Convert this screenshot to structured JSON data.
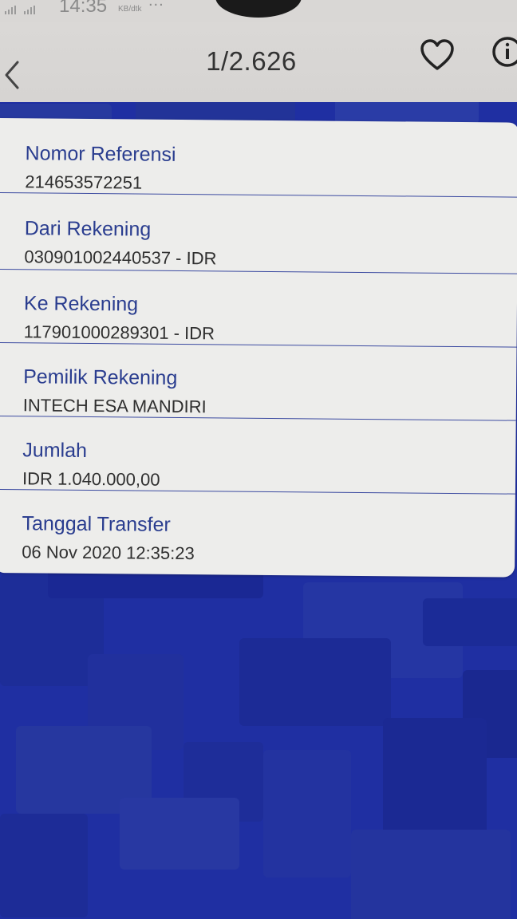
{
  "status_bar": {
    "time": "14:35",
    "speed_unit": "KB/dtk",
    "more": "..."
  },
  "header": {
    "page_indicator": "1/2.626",
    "back_icon": "chevron-left-icon",
    "favorite_icon": "heart-icon",
    "info_icon": "info-icon"
  },
  "details": [
    {
      "label": "Nomor Referensi",
      "value": "214653572251"
    },
    {
      "label": "Dari Rekening",
      "value": "030901002440537 - IDR"
    },
    {
      "label": "Ke Rekening",
      "value": "117901000289301 - IDR"
    },
    {
      "label": "Pemilik Rekening",
      "value": "INTECH ESA MANDIRI"
    },
    {
      "label": "Jumlah",
      "value": "IDR 1.040.000,00"
    },
    {
      "label": "Tanggal Transfer",
      "value": "06 Nov 2020 12:35:23"
    }
  ],
  "colors": {
    "background_blue": "#1f2fa2",
    "label_blue": "#2a3d8f",
    "card_bg": "#ededeb",
    "divider": "#3b4aa0"
  }
}
